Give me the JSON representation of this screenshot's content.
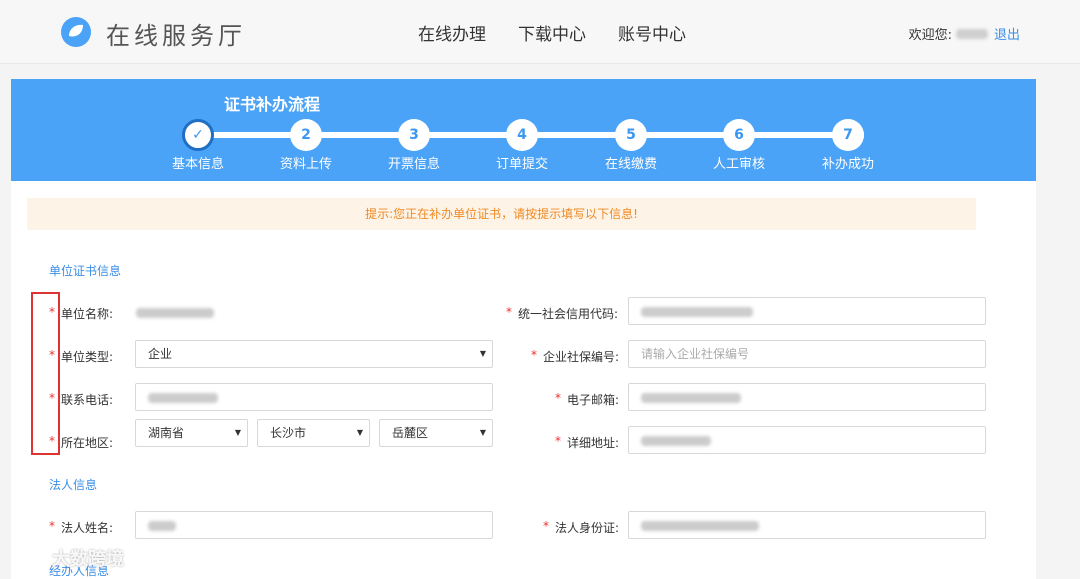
{
  "header": {
    "brand": "在线服务厅",
    "nav": [
      "在线办理",
      "下载中心",
      "账号中心"
    ],
    "welcome": "欢迎您:",
    "logout": "退出",
    "accent": "#4ba3f7"
  },
  "progress": {
    "title": "证书补办流程",
    "steps": [
      {
        "num": "✓",
        "label": "基本信息"
      },
      {
        "num": "2",
        "label": "资料上传"
      },
      {
        "num": "3",
        "label": "开票信息"
      },
      {
        "num": "4",
        "label": "订单提交"
      },
      {
        "num": "5",
        "label": "在线缴费"
      },
      {
        "num": "6",
        "label": "人工审核"
      },
      {
        "num": "7",
        "label": "补办成功"
      }
    ]
  },
  "notice": "提示:您正在补办单位证书，请按提示填写以下信息!",
  "unit_section": {
    "title": "单位证书信息",
    "required_mark": "*",
    "labels": {
      "name": "单位名称:",
      "credit_code": "统一社会信用代码:",
      "type": "单位类型:",
      "social_no": "企业社保编号:",
      "phone": "联系电话:",
      "email": "电子邮箱:",
      "region": "所在地区:",
      "address": "详细地址:"
    },
    "type_value": "企业",
    "social_no_placeholder": "请输入企业社保编号",
    "province": "湖南省",
    "city": "长沙市",
    "district": "岳麓区"
  },
  "legal_section": {
    "title": "法人信息",
    "labels": {
      "name": "法人姓名:",
      "id": "法人身份证:"
    }
  },
  "handler_section": {
    "title": "经办人信息"
  },
  "watermark": "大数跨境"
}
